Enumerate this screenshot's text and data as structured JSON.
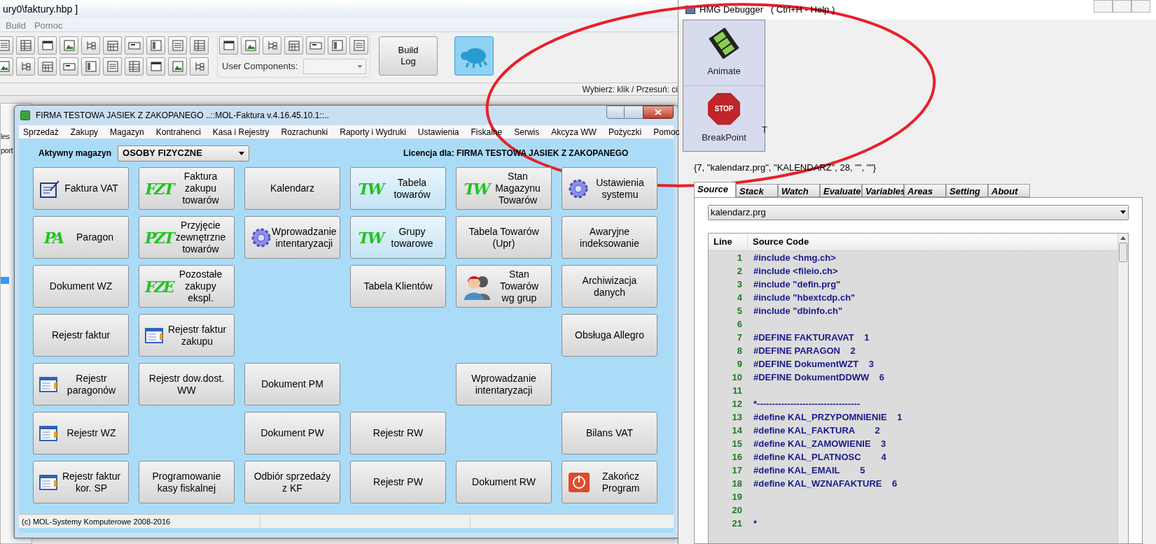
{
  "ide": {
    "title": "ury0\\faktury.hbp ]",
    "menu": [
      "Build",
      "Pomoc"
    ],
    "user_components_label": "User Components:",
    "build_log_button": "Build Log",
    "status": "Wybierz: klik / Przesuń: ci",
    "side_fragments": [
      "les",
      "port"
    ]
  },
  "main_window": {
    "title": "FIRMA TESTOWA JASIEK Z ZAKOPANEGO ..::MOL-Faktura v.4.16.45.10.1::..",
    "menu": [
      "Sprzedaż",
      "Zakupy",
      "Magazyn",
      "Kontrahenci",
      "Kasa i Rejestry",
      "Rozrachunki",
      "Raporty i Wydruki",
      "Ustawienia",
      "Fiskalne",
      "Serwis",
      "Akcyza WW",
      "Pożyczki",
      "Pomoc"
    ],
    "store_label": "Aktywny magazyn",
    "store_value": "OSOBY FIZYCZNE",
    "license": "Licencja dla: FIRMA TESTOWA JASIEK Z ZAKOPANEGO",
    "button_rows": [
      [
        {
          "kind": "form",
          "label": "Faktura VAT",
          "highlighted": false
        },
        {
          "kind": "letters",
          "label": "Faktura zakupu towarów",
          "logo": "FZT",
          "highlighted": false
        },
        {
          "kind": "plain",
          "label": "Kalendarz",
          "highlighted": false
        },
        {
          "kind": "letters",
          "label": "Tabela towarów",
          "logo": "TW",
          "highlighted": true
        },
        {
          "kind": "letters",
          "label": "Stan Magazynu Towarów",
          "logo": "TW",
          "highlighted": false
        },
        {
          "kind": "gear",
          "label": "Ustawienia systemu",
          "highlighted": false
        }
      ],
      [
        {
          "kind": "letters",
          "label": "Paragon",
          "logo": "PA",
          "highlighted": false
        },
        {
          "kind": "letters",
          "label": "Przyjęcie zewnętrzne towarów",
          "logo": "PZT",
          "highlighted": false
        },
        {
          "kind": "gear",
          "label": "Wprowadzanie intentaryzacji",
          "highlighted": false
        },
        {
          "kind": "letters",
          "label": "Grupy towarowe",
          "logo": "TW",
          "highlighted": true
        },
        {
          "kind": "plain",
          "label": "Tabela Towarów (Upr)",
          "highlighted": false
        },
        {
          "kind": "plain",
          "label": "Awaryjne indeksowanie",
          "highlighted": false
        }
      ],
      [
        {
          "kind": "plain",
          "label": "Dokument WZ",
          "highlighted": false
        },
        {
          "kind": "letters",
          "label": "Pozostałe zakupy ekspl.",
          "logo": "FZE",
          "highlighted": false
        },
        {
          "kind": "empty"
        },
        {
          "kind": "plain",
          "label": "Tabela Klientów",
          "highlighted": false
        },
        {
          "kind": "people",
          "label": "Stan Towarów wg grup",
          "highlighted": false
        },
        {
          "kind": "plain",
          "label": "Archiwizacja danych",
          "highlighted": false
        }
      ],
      [
        {
          "kind": "plain",
          "label": "Rejestr faktur",
          "highlighted": false
        },
        {
          "kind": "register",
          "label": "Rejestr faktur zakupu",
          "highlighted": false
        },
        {
          "kind": "empty"
        },
        {
          "kind": "empty"
        },
        {
          "kind": "empty"
        },
        {
          "kind": "plain",
          "label": "Obsługa Allegro",
          "highlighted": false
        }
      ],
      [
        {
          "kind": "register",
          "label": "Rejestr paragonów",
          "highlighted": false
        },
        {
          "kind": "plain",
          "label": "Rejestr dow.dost. WW",
          "highlighted": false
        },
        {
          "kind": "plain",
          "label": "Dokument PM",
          "highlighted": false
        },
        {
          "kind": "empty"
        },
        {
          "kind": "plain",
          "label": "Wprowadzanie intentaryzacji",
          "highlighted": false
        },
        {
          "kind": "empty"
        }
      ],
      [
        {
          "kind": "register",
          "label": "Rejestr WZ",
          "highlighted": false
        },
        {
          "kind": "empty"
        },
        {
          "kind": "plain",
          "label": "Dokument PW",
          "highlighted": false
        },
        {
          "kind": "plain",
          "label": "Rejestr RW",
          "highlighted": false
        },
        {
          "kind": "empty"
        },
        {
          "kind": "plain",
          "label": "Bilans VAT",
          "highlighted": false
        }
      ],
      [
        {
          "kind": "register",
          "label": "Rejestr faktur kor. SP",
          "highlighted": false
        },
        {
          "kind": "plain",
          "label": "Programowanie kasy fiskalnej",
          "highlighted": false
        },
        {
          "kind": "plain",
          "label": "Odbiór sprzedaży z KF",
          "highlighted": false
        },
        {
          "kind": "plain",
          "label": "Rejestr PW",
          "highlighted": false
        },
        {
          "kind": "plain",
          "label": "Dokument RW",
          "highlighted": false
        },
        {
          "kind": "power",
          "label": "Zakończ Program",
          "highlighted": false
        }
      ]
    ],
    "status_bar": [
      "(c) MOL-Systemy Komputerowe 2008-2016"
    ]
  },
  "debugger": {
    "title": "HMG Debugger   ( Ctrl+H - Help )",
    "tools": [
      {
        "label": "Animate",
        "kind": "film"
      },
      {
        "label": "BreakPoint",
        "kind": "stop",
        "logo": "STOP"
      }
    ],
    "cut_label": "T",
    "expression": "{7, \"kalendarz.prg\", \"KALENDARZ\", 28, \"\", \"\"}",
    "tabs": [
      {
        "label": "Source",
        "selected": true
      },
      {
        "label": "Stack",
        "selected": false
      },
      {
        "label": "Watch",
        "selected": false
      },
      {
        "label": "Evaluate",
        "selected": false
      },
      {
        "label": "Variables",
        "selected": false
      },
      {
        "label": "Areas",
        "selected": false
      },
      {
        "label": "Setting",
        "selected": false
      },
      {
        "label": "About",
        "selected": false
      }
    ],
    "file": "kalendarz.prg",
    "columns": [
      "Line",
      "Source Code"
    ],
    "lines": [
      {
        "line": "1",
        "code": "#include <hmg.ch>"
      },
      {
        "line": "2",
        "code": "#include <fileio.ch>"
      },
      {
        "line": "3",
        "code": "#include \"defin.prg\""
      },
      {
        "line": "4",
        "code": "#include \"hbextcdp.ch\""
      },
      {
        "line": "5",
        "code": "#include \"dbinfo.ch\""
      },
      {
        "line": "6"
      },
      {
        "line": "7",
        "code": "#DEFINE FAKTURAVAT    1"
      },
      {
        "line": "8",
        "code": "#DEFINE PARAGON    2"
      },
      {
        "line": "9",
        "code": "#DEFINE DokumentWZT    3"
      },
      {
        "line": "10",
        "code": "#DEFINE DokumentDDWW    6"
      },
      {
        "line": "11"
      },
      {
        "line": "12",
        "code": "*----------------------------------"
      },
      {
        "line": "13",
        "code": "#define KAL_PRZYPOMNIENIE    1"
      },
      {
        "line": "14",
        "code": "#define KAL_FAKTURA        2"
      },
      {
        "line": "15",
        "code": "#define KAL_ZAMOWIENIE    3"
      },
      {
        "line": "16",
        "code": "#define KAL_PLATNOSC        4"
      },
      {
        "line": "17",
        "code": "#define KAL_EMAIL        5"
      },
      {
        "line": "18",
        "code": "#define KAL_WZNAFAKTURE    6"
      },
      {
        "line": "19"
      },
      {
        "line": "20"
      },
      {
        "line": "21",
        "code": "*"
      }
    ]
  }
}
